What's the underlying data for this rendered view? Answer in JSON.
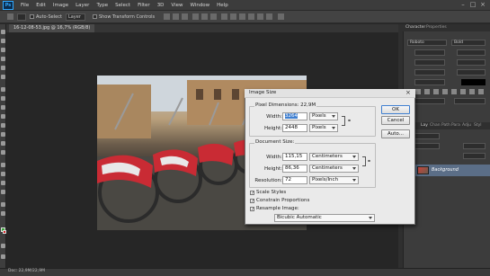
{
  "app": {
    "logo": "Ps"
  },
  "menu": [
    "File",
    "Edit",
    "Image",
    "Layer",
    "Type",
    "Select",
    "Filter",
    "3D",
    "View",
    "Window",
    "Help"
  ],
  "options_bar": {
    "auto_select_label": "Auto-Select",
    "auto_select_target": "Layer",
    "show_transform_label": "Show Transform Controls"
  },
  "document": {
    "tab_label": "16-12-08-53.jpg @ 16,7% (RGB/8)"
  },
  "status": {
    "text": "Doc: 22,9M/22,9M"
  },
  "right_panel": {
    "tabs": [
      "Character",
      "Properties"
    ],
    "font_family": "Roboto",
    "font_style": "Bold",
    "layers_tabs": [
      "Lay",
      "Chan",
      "Path",
      "Para",
      "Adju",
      "Styl"
    ],
    "layer_name": "Background"
  },
  "image_size_dialog": {
    "title": "Image Size",
    "close": "×",
    "pixel_dimensions_label": "Pixel Dimensions: 22,9M",
    "width_label": "Width:",
    "pixel_width": "3264",
    "pixel_width_unit": "Pixels",
    "height_label": "Height:",
    "pixel_height": "2448",
    "pixel_height_unit": "Pixels",
    "document_size_label": "Document Size:",
    "doc_width": "115,15",
    "doc_width_unit": "Centimeters",
    "doc_height": "86,36",
    "doc_height_unit": "Centimeters",
    "resolution_label": "Resolution:",
    "resolution": "72",
    "resolution_unit": "Pixels/Inch",
    "scale_styles_label": "Scale Styles",
    "constrain_label": "Constrain Proportions",
    "resample_label": "Resample Image:",
    "resample_method": "Bicubic Automatic",
    "ok_label": "OK",
    "cancel_label": "Cancel",
    "auto_label": "Auto..."
  },
  "colors": {
    "accent": "#31a8ff",
    "selection": "#3f7fd0",
    "foreground_swatch": "#3aa63a",
    "background_swatch": "#d42020"
  }
}
